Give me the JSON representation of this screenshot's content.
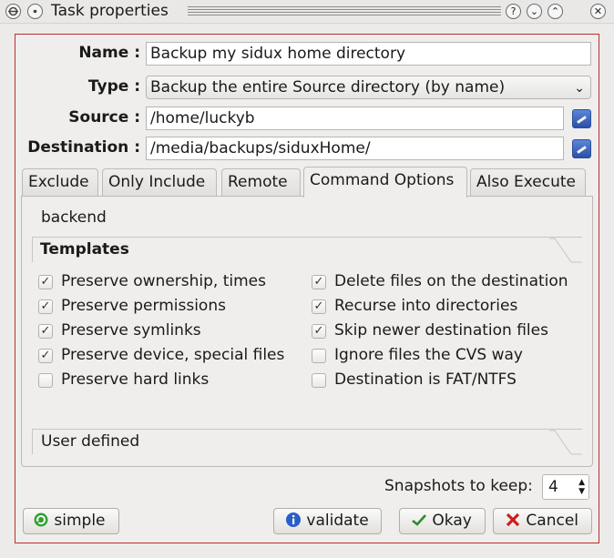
{
  "window": {
    "title": "Task properties",
    "buttons": [
      "?",
      "⌄",
      "⌃",
      "✕"
    ]
  },
  "form": {
    "name_label": "Name :",
    "name_value": "Backup my sidux home directory",
    "type_label": "Type :",
    "type_value": "Backup the entire Source directory (by name)",
    "source_label": "Source :",
    "source_value": "/home/luckyb",
    "destination_label": "Destination :",
    "destination_value": "/media/backups/siduxHome/"
  },
  "tabs": [
    {
      "label": "Exclude",
      "active": false
    },
    {
      "label": "Only Include",
      "active": false
    },
    {
      "label": "Remote",
      "active": false
    },
    {
      "label": "Command Options",
      "active": true
    },
    {
      "label": "Also Execute",
      "active": false
    }
  ],
  "command_options": {
    "backend_label": "backend",
    "templates_label": "Templates",
    "user_defined_label": "User defined",
    "left_options": [
      {
        "label": "Preserve ownership, times",
        "checked": true
      },
      {
        "label": "Preserve permissions",
        "checked": true
      },
      {
        "label": "Preserve symlinks",
        "checked": true
      },
      {
        "label": "Preserve device, special files",
        "checked": true
      },
      {
        "label": "Preserve hard links",
        "checked": false
      }
    ],
    "right_options": [
      {
        "label": "Delete files on the destination",
        "checked": true
      },
      {
        "label": "Recurse into directories",
        "checked": true
      },
      {
        "label": "Skip newer destination files",
        "checked": true
      },
      {
        "label": "Ignore files the CVS way",
        "checked": false
      },
      {
        "label": "Destination is FAT/NTFS",
        "checked": false
      }
    ]
  },
  "snapshots": {
    "label": "Snapshots to keep:",
    "value": "4"
  },
  "footer": {
    "simple_label": "simple",
    "validate_label": "validate",
    "okay_label": "Okay",
    "cancel_label": "Cancel"
  },
  "colors": {
    "frame_border": "#b92f2f",
    "accent_blue": "#2a4fa8",
    "ok_green": "#2e8b2e",
    "cancel_red": "#cc1f1f"
  }
}
